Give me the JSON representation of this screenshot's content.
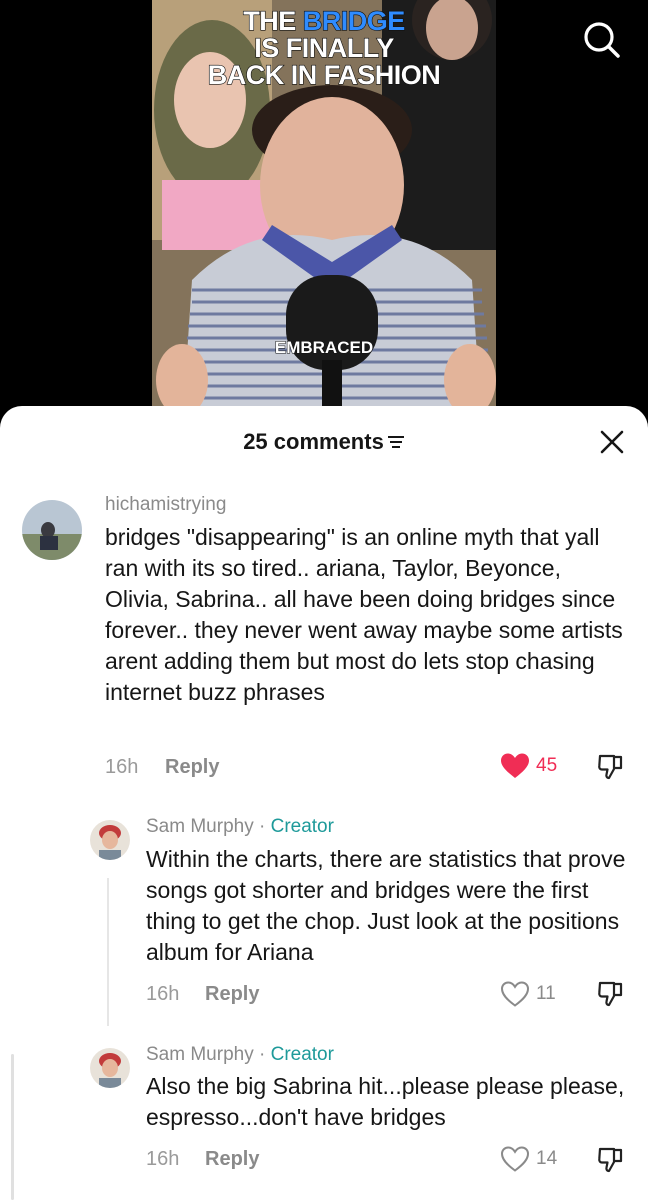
{
  "video": {
    "headline_part1": "THE ",
    "headline_highlight": "BRIDGE",
    "headline_line2": "IS FINALLY",
    "headline_line3": "BACK IN FASHION",
    "caption": "EMBRACED",
    "search_icon": "search-icon"
  },
  "comments_header": {
    "count_label": "25 comments",
    "filter_icon": "sort-filter-icon",
    "close_icon": "close-icon"
  },
  "comments": [
    {
      "username": "hichamistrying",
      "text": "bridges \"disappearing\" is an online myth that yall ran with its so tired.. ariana, Taylor, Beyonce, Olivia, Sabrina.. all have been doing bridges since forever.. they never went away maybe some artists arent adding them but most do lets stop chasing internet buzz phrases",
      "time": "16h",
      "reply_label": "Reply",
      "likes": "45",
      "liked": true
    }
  ],
  "replies": [
    {
      "username": "Sam Murphy",
      "separator": " · ",
      "badge": "Creator",
      "text": "Within the charts, there are statistics that prove songs got shorter and bridges were the first thing to get the chop. Just look at the positions album for Ariana",
      "time": "16h",
      "reply_label": "Reply",
      "likes": "11",
      "liked": false
    },
    {
      "username": "Sam Murphy",
      "separator": " · ",
      "badge": "Creator",
      "text": "Also the big Sabrina hit...please please please, espresso...don't have bridges",
      "time": "16h",
      "reply_label": "Reply",
      "likes": "14",
      "liked": false
    }
  ],
  "colors": {
    "like_red": "#f02d55",
    "creator_teal": "#1e9a9a",
    "muted_gray": "#8a8a8a",
    "headline_blue": "#2f8cff"
  }
}
